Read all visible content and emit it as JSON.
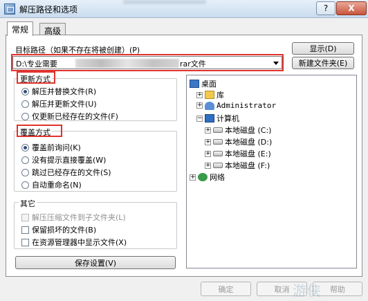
{
  "window": {
    "title": "解压路径和选项",
    "help_label": "?",
    "close_label": "X"
  },
  "tabs": [
    {
      "label": "常规",
      "active": true
    },
    {
      "label": "高级",
      "active": false
    }
  ],
  "destination": {
    "label": "目标路径（如果不存在将被创建）(P)",
    "path_prefix": "D:\\专业需要",
    "path_suffix": "rar文件",
    "show_button": "显示(D)",
    "new_folder_button": "新建文件夹(E)"
  },
  "update_mode": {
    "label": "更新方式",
    "options": [
      {
        "label": "解压并替换文件(R)",
        "selected": true
      },
      {
        "label": "解压并更新文件(U)",
        "selected": false
      },
      {
        "label": "仅更新已经存在的文件(F)",
        "selected": false
      }
    ]
  },
  "overwrite_mode": {
    "label": "覆盖方式",
    "options": [
      {
        "label": "覆盖前询问(K)",
        "selected": true
      },
      {
        "label": "没有提示直接覆盖(W)",
        "selected": false
      },
      {
        "label": "跳过已经存在的文件(S)",
        "selected": false
      },
      {
        "label": "自动重命名(N)",
        "selected": false
      }
    ]
  },
  "misc": {
    "label": "其它",
    "options": [
      {
        "label": "解压压缩文件到子文件夹(L)",
        "checked": false,
        "enabled": false
      },
      {
        "label": "保留损坏的文件(B)",
        "checked": false,
        "enabled": true
      },
      {
        "label": "在资源管理器中显示文件(X)",
        "checked": false,
        "enabled": true
      }
    ]
  },
  "save_settings_button": "保存设置(V)",
  "tree": {
    "items": [
      {
        "label": "桌面",
        "icon": "desktop-icon"
      },
      {
        "label": "库",
        "icon": "library-icon"
      },
      {
        "label": "Administrator",
        "icon": "user-folder-icon"
      },
      {
        "label": "计算机",
        "icon": "computer-icon"
      },
      {
        "label": "本地磁盘 (C:)",
        "icon": "drive-icon"
      },
      {
        "label": "本地磁盘 (D:)",
        "icon": "drive-icon"
      },
      {
        "label": "本地磁盘 (E:)",
        "icon": "drive-icon"
      },
      {
        "label": "本地磁盘 (F:)",
        "icon": "drive-icon"
      },
      {
        "label": "网络",
        "icon": "network-icon"
      }
    ]
  },
  "footer": {
    "ok_label": "确定",
    "cancel_label": "取消",
    "help_label": "帮助"
  },
  "watermark": "游侠"
}
